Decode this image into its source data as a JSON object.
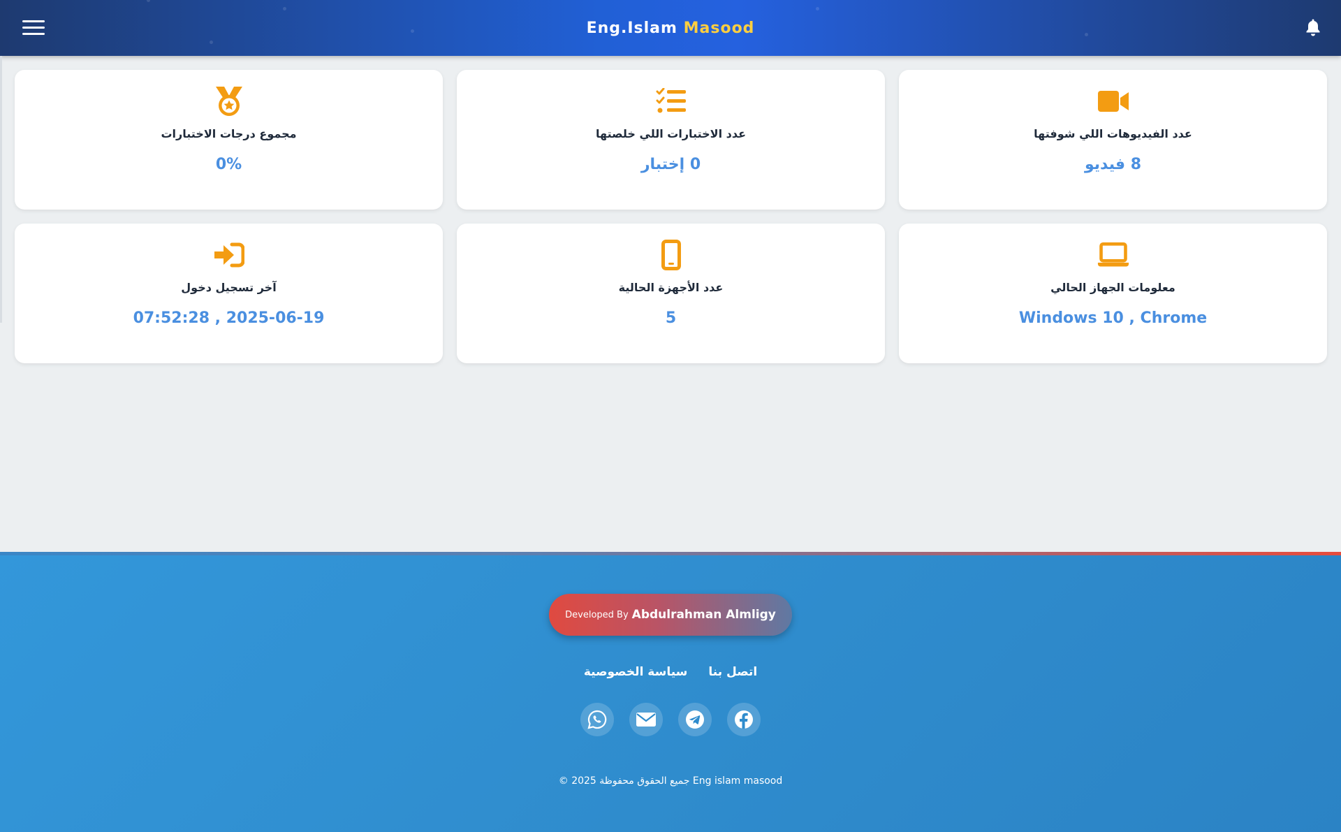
{
  "header": {
    "brand_prefix": "Eng.Islam",
    "brand_accent": "Masood",
    "menu_icon": "hamburger-icon",
    "bell_icon": "bell-icon"
  },
  "cards": [
    {
      "icon": "video-camera-icon",
      "label": "عدد الفيديوهات اللي شوفتها",
      "value": "8 فيديو"
    },
    {
      "icon": "checklist-icon",
      "label": "عدد الاختبارات اللي خلصتها",
      "value": "0 إختبار"
    },
    {
      "icon": "medal-icon",
      "label": "مجموع درجات الاختبارات",
      "value": "0%"
    },
    {
      "icon": "laptop-icon",
      "label": "معلومات الجهاز الحالي",
      "value": "Windows 10 , Chrome"
    },
    {
      "icon": "mobile-phone-icon",
      "label": "عدد الأجهزة الحالية",
      "value": "5"
    },
    {
      "icon": "sign-in-icon",
      "label": "آخر تسجيل دخول",
      "value": "2025-06-19 , 07:52:28"
    }
  ],
  "footer": {
    "developed_by": "Developed By",
    "developer_name": "Abdulrahman Almligy",
    "links": [
      {
        "label": "اتصل بنا"
      },
      {
        "label": "سياسة الخصوصية"
      }
    ],
    "socials": [
      "facebook-icon",
      "telegram-icon",
      "email-icon",
      "whatsapp-icon"
    ],
    "copyright": "© جميع الحقوق محفوظة 2025 Eng islam masood"
  },
  "colors": {
    "accent_orange": "#f39c12",
    "value_blue": "#4a8fe0",
    "brand_yellow": "#ffcf3f",
    "header_blue": "#2160d6",
    "footer_blue": "#3397da"
  }
}
